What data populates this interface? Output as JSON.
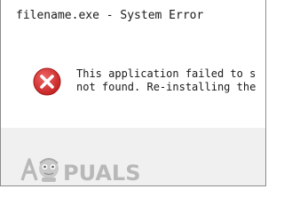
{
  "window": {
    "title": "filename.exe - System Error"
  },
  "message": {
    "line1": "This application failed to s",
    "line2": "not found. Re-installing the"
  },
  "icons": {
    "error": "error-x-icon"
  },
  "watermark": {
    "text": "APPUALS",
    "logo_name": "appuals-logo"
  },
  "colors": {
    "error_red_light": "#f06464",
    "error_red_dark": "#c21e1e",
    "footer_bg": "#f0f0f0",
    "text": "#1a1a1a"
  }
}
